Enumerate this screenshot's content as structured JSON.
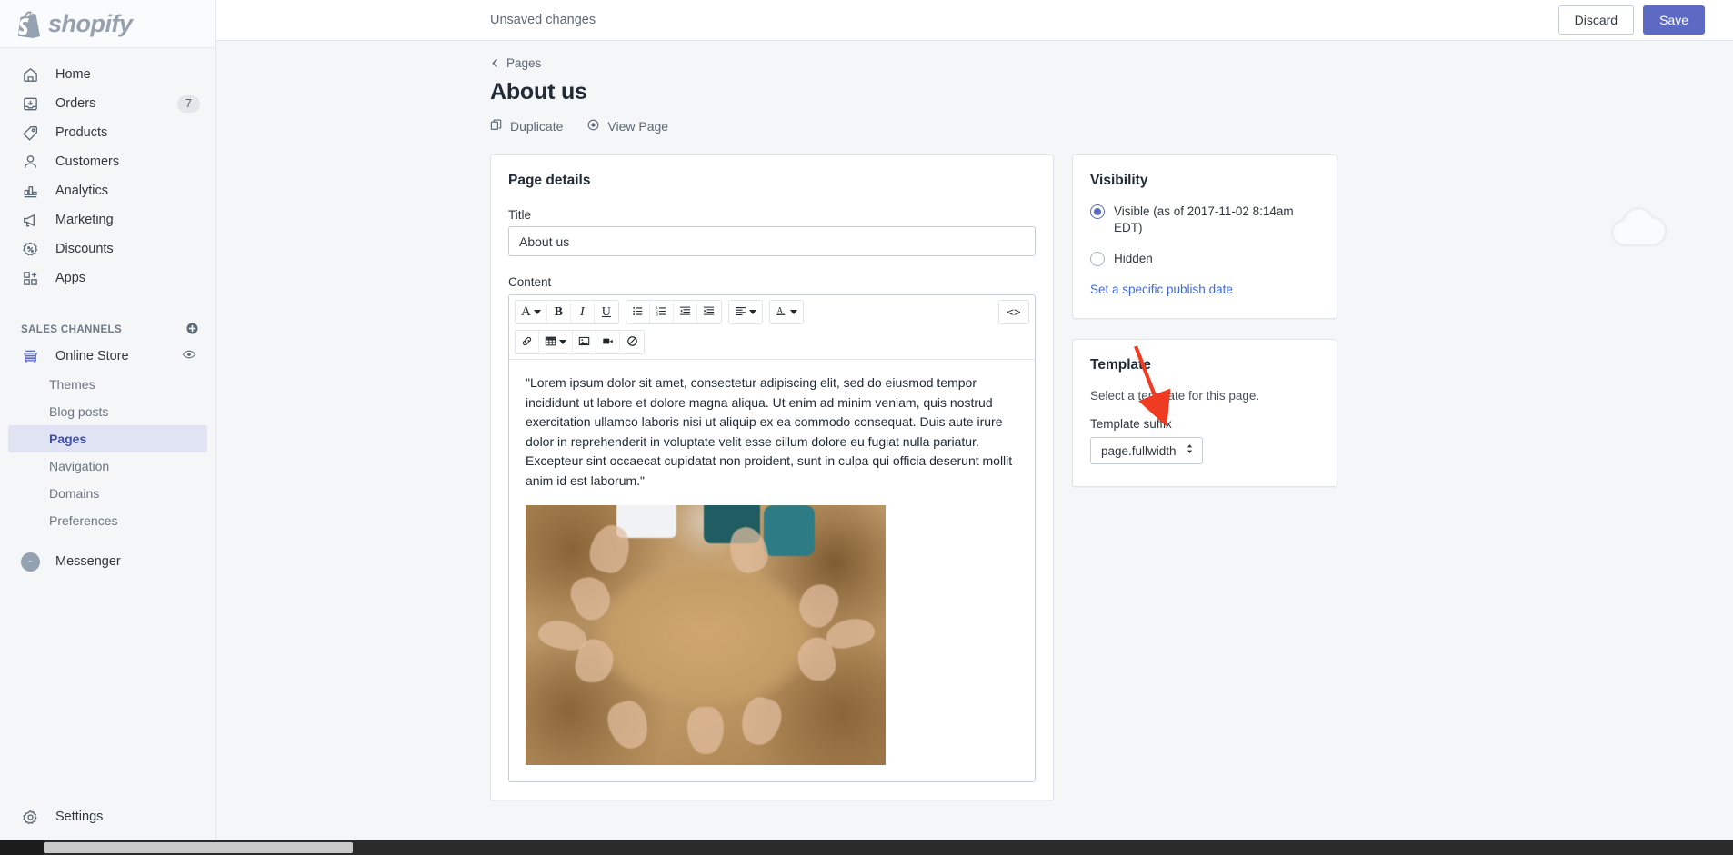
{
  "brand": {
    "name": "shopify",
    "logo_icon": "shopify-bag-icon"
  },
  "topbar": {
    "unsaved_text": "Unsaved changes",
    "discard_label": "Discard",
    "save_label": "Save",
    "save_color": "#5c6ac4"
  },
  "sidebar": {
    "primary": [
      {
        "label": "Home",
        "icon": "home-icon",
        "badge": ""
      },
      {
        "label": "Orders",
        "icon": "orders-inbox-icon",
        "badge": "7"
      },
      {
        "label": "Products",
        "icon": "tag-icon",
        "badge": ""
      },
      {
        "label": "Customers",
        "icon": "person-icon",
        "badge": ""
      },
      {
        "label": "Analytics",
        "icon": "bar-chart-icon",
        "badge": ""
      },
      {
        "label": "Marketing",
        "icon": "megaphone-icon",
        "badge": ""
      },
      {
        "label": "Discounts",
        "icon": "discount-percent-icon",
        "badge": ""
      },
      {
        "label": "Apps",
        "icon": "apps-grid-plus-icon",
        "badge": ""
      }
    ],
    "section_label": "SALES CHANNELS",
    "section_add_icon": "plus-circle-icon",
    "channel": {
      "label": "Online Store",
      "icon": "storefront-icon",
      "action_icon": "eye-icon"
    },
    "channel_items": [
      {
        "label": "Themes",
        "active": false
      },
      {
        "label": "Blog posts",
        "active": false
      },
      {
        "label": "Pages",
        "active": true
      },
      {
        "label": "Navigation",
        "active": false
      },
      {
        "label": "Domains",
        "active": false
      },
      {
        "label": "Preferences",
        "active": false
      }
    ],
    "messenger": {
      "label": "Messenger",
      "icon": "messenger-icon"
    },
    "settings": {
      "label": "Settings",
      "icon": "gear-icon"
    },
    "active_color": "#3f4eae",
    "active_bg": "#dfe3f3"
  },
  "page": {
    "breadcrumb_label": "Pages",
    "breadcrumb_icon": "chevron-left-icon",
    "title": "About us",
    "actions": [
      {
        "label": "Duplicate",
        "icon": "duplicate-icon"
      },
      {
        "label": "View Page",
        "icon": "eye-icon"
      }
    ]
  },
  "page_details": {
    "card_title": "Page details",
    "title_label": "Title",
    "title_value": "About us",
    "title_placeholder": "",
    "content_label": "Content"
  },
  "editor": {
    "toolbar_row1": [
      {
        "name": "font-style-dropdown",
        "glyph": "A",
        "caret": true
      },
      {
        "name": "bold-button",
        "glyph": "B",
        "caret": false
      },
      {
        "name": "italic-button",
        "glyph": "I",
        "caret": false
      },
      {
        "name": "underline-button",
        "glyph": "U",
        "caret": false
      },
      {
        "name": "bullet-list-button",
        "glyph": "list-ul-icon",
        "caret": false
      },
      {
        "name": "numbered-list-button",
        "glyph": "list-ol-icon",
        "caret": false
      },
      {
        "name": "outdent-button",
        "glyph": "outdent-icon",
        "caret": false
      },
      {
        "name": "indent-button",
        "glyph": "indent-icon",
        "caret": false
      },
      {
        "name": "align-dropdown",
        "glyph": "align-left-icon",
        "caret": true
      },
      {
        "name": "text-color-dropdown",
        "glyph": "A-underline-icon",
        "caret": true
      }
    ],
    "toolbar_row2": [
      {
        "name": "insert-link-button",
        "glyph": "link-icon",
        "caret": false
      },
      {
        "name": "insert-table-dropdown",
        "glyph": "table-icon",
        "caret": true
      },
      {
        "name": "insert-image-button",
        "glyph": "image-icon",
        "caret": false
      },
      {
        "name": "insert-video-button",
        "glyph": "video-icon",
        "caret": false
      },
      {
        "name": "clear-formatting-button",
        "glyph": "no-entry-icon",
        "caret": false
      }
    ],
    "code_view_label": "<>",
    "body_text": "\"Lorem ipsum dolor sit amet, consectetur adipiscing elit, sed do eiusmod tempor incididunt ut labore et dolore magna aliqua. Ut enim ad minim veniam, quis nostrud exercitation ullamco laboris nisi ut aliquip ex ea commodo consequat. Duis aute irure dolor in reprehenderit in voluptate velit esse cillum dolore eu fugiat nulla pariatur. Excepteur sint occaecat cupidatat non proident, sunt in culpa qui officia deserunt mollit anim id est laborum.\"",
    "image_alt": "hands-circle-photo"
  },
  "visibility": {
    "card_title": "Visibility",
    "options": [
      {
        "label": "Visible (as of 2017-11-02 8:14am EDT)",
        "selected": true
      },
      {
        "label": "Hidden",
        "selected": false
      }
    ],
    "publish_link": "Set a specific publish date"
  },
  "template": {
    "card_title": "Template",
    "help_text": "Select a template for this page.",
    "suffix_label": "Template suffix",
    "suffix_value": "page.fullwidth"
  },
  "annotation": {
    "arrow_color": "#ef3b21",
    "target": "template-suffix-select"
  },
  "watermark": {
    "icon": "cloud-icon"
  }
}
